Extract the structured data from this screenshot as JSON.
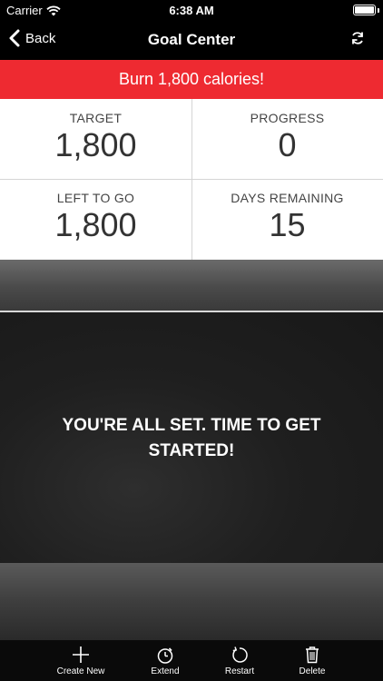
{
  "status": {
    "carrier": "Carrier",
    "time": "6:38 AM"
  },
  "nav": {
    "back_label": "Back",
    "title": "Goal Center"
  },
  "banner": {
    "text": "Burn 1,800 calories!",
    "color": "#ee2a31"
  },
  "stats": {
    "target": {
      "label": "TARGET",
      "value": "1,800"
    },
    "progress": {
      "label": "PROGRESS",
      "value": "0"
    },
    "left_to_go": {
      "label": "LEFT TO GO",
      "value": "1,800"
    },
    "days_remaining": {
      "label": "DAYS REMAINING",
      "value": "15"
    }
  },
  "message": "YOU'RE ALL SET. TIME TO GET STARTED!",
  "toolbar": {
    "create_new": {
      "label": "Create New",
      "icon": "plus-icon"
    },
    "extend": {
      "label": "Extend",
      "icon": "stopwatch-icon"
    },
    "restart": {
      "label": "Restart",
      "icon": "restart-icon"
    },
    "delete": {
      "label": "Delete",
      "icon": "trash-icon"
    }
  }
}
